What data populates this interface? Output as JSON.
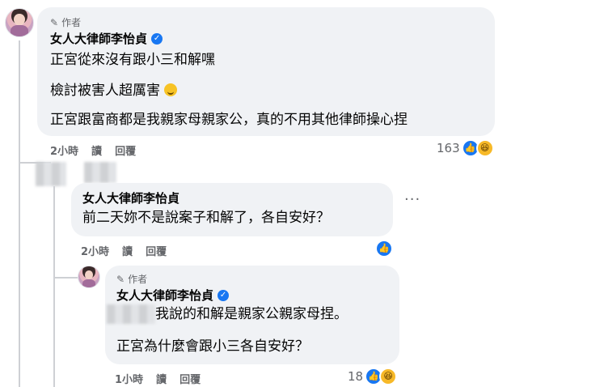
{
  "comments": [
    {
      "author_badge": "作者",
      "author_name": "女人大律師李怡貞",
      "lines": [
        "正宮從來沒有跟小三和解嘿",
        "檢討被害人超厲害",
        "正宮跟富商都是我親家母親家公，真的不用其他律師操心捏"
      ],
      "emoji_icon": "smirk-emoji-icon",
      "time": "2小時",
      "action_view": "讀",
      "action_reply": "回覆",
      "reaction_count": "163",
      "reaction_icons": [
        "like-icon",
        "haha-icon"
      ]
    },
    {
      "author_name": "女人大律師李怡貞",
      "line": "前二天妳不是說案子和解了，各自安好？",
      "time": "2小時",
      "action_view": "讀",
      "action_reply": "回覆",
      "more": "···"
    },
    {
      "author_badge": "作者",
      "author_name": "女人大律師李怡貞",
      "lines": [
        "我說的和解是親家公親家母捏。",
        "正宮為什麼會跟小三各自安好？"
      ],
      "time": "1小時",
      "action_view": "讀",
      "action_reply": "回覆",
      "reaction_count": "18",
      "reaction_icons": [
        "like-icon",
        "haha-icon"
      ]
    }
  ],
  "colors": {
    "bubble": "#f0f2f5",
    "meta": "#65676b",
    "like": "#1877f2",
    "haha": "#f7b928"
  }
}
